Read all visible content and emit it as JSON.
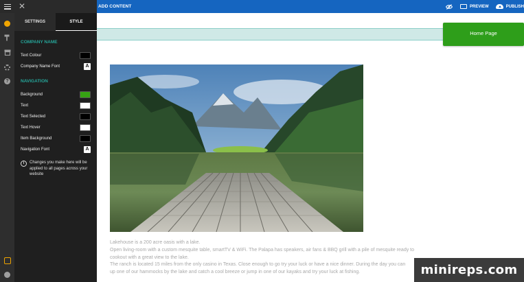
{
  "topbar": {
    "add_content": "ADD CONTENT",
    "preview": "PREVIEW",
    "publish": "PUBLISH"
  },
  "panel": {
    "tabs": [
      "SETTINGS",
      "STYLE"
    ],
    "active_tab": "STYLE",
    "company_section": "COMPANY NAME",
    "company_rows": [
      {
        "label": "Text Colour",
        "kind": "swatch",
        "color": "#000000"
      },
      {
        "label": "Company Name Font",
        "kind": "font",
        "glyph": "A"
      }
    ],
    "navigation_section": "NAVIGATION",
    "navigation_rows": [
      {
        "label": "Background",
        "kind": "swatch",
        "color": "#36a313"
      },
      {
        "label": "Text",
        "kind": "swatch",
        "color": "#ffffff"
      },
      {
        "label": "Text Selected",
        "kind": "swatch",
        "color": "#000000"
      },
      {
        "label": "Text Hover",
        "kind": "swatch",
        "color": "#ffffff"
      },
      {
        "label": "Item Background",
        "kind": "swatch",
        "color": "#000000"
      },
      {
        "label": "Navigation Font",
        "kind": "font",
        "glyph": "A"
      }
    ],
    "info": "Changes you make here will be applied to all pages across your website"
  },
  "page": {
    "nav_button": "Home Page",
    "body_lines": [
      "Lakehouse is a 200 acre oasis with a lake.",
      "Open living-room with a custom mesquite table, smartTV & WiFi. The Palapa has speakers, air fans & BBQ grill with a pile of mesquite ready to",
      "cookout with a great view to the lake.",
      "The ranch is located 15 miles from the only casino in Texas. Close enough to go try your luck or have a nice dinner. During the day you can",
      "up one of our hammocks by the lake and catch a cool breeze or jump in one of our kayaks and try your luck at fishing."
    ]
  },
  "watermark": "minireps.com",
  "colors": {
    "topbar": "#1565c0",
    "panel": "#1f1f1f",
    "accent": "#26a69a",
    "nav_button": "#2e9e1a",
    "nav_strip": "#cfe9e6"
  },
  "icons": [
    "menu-icon",
    "close-icon",
    "globe-icon",
    "paint-roller-icon",
    "store-icon",
    "gear-icon",
    "help-icon",
    "hexagon-icon",
    "user-icon",
    "eye-slash-icon",
    "monitor-icon",
    "cloud-upload-icon",
    "info-icon",
    "font-icon"
  ]
}
